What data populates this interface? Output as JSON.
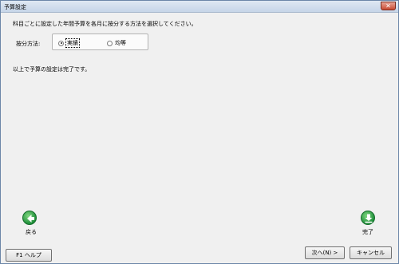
{
  "window": {
    "title": "予算設定",
    "close_glyph": "✕"
  },
  "main": {
    "instruction": "科目ごとに設定した年間予算を各月に按分する方法を選択してください。",
    "method_label": "按分方法:",
    "options": [
      {
        "label": "実績",
        "selected": true
      },
      {
        "label": "均等",
        "selected": false
      }
    ],
    "complete_message": "以上で予算の設定は完了です。"
  },
  "nav": {
    "back_label": "戻る",
    "back_icon": "left-arrow-icon",
    "finish_label": "完了",
    "finish_icon": "download-arrow-icon"
  },
  "buttons": {
    "help": "F1 ヘルプ",
    "next": "次へ(N) >",
    "cancel": "キャンセル"
  },
  "colors": {
    "icon_green": "#1f8f3a",
    "title_bar": "#c6d5e8"
  }
}
